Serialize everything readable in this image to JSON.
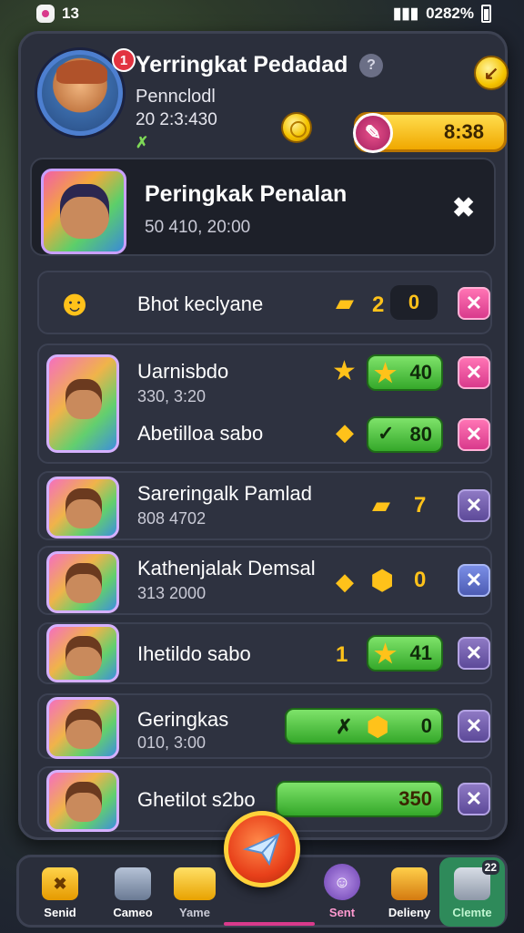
{
  "status_bar": {
    "left_text": "13",
    "right_text": "0282%"
  },
  "header": {
    "title": "Yerringkat Pedadad",
    "subtitle": "Pennclodl",
    "time": "20 2:3:430",
    "notification_count": "1",
    "help_label": "?",
    "pill_value": "8:38",
    "small_icon_text": "✗"
  },
  "featured": {
    "title": "Peringkak Penalan",
    "time": "50 410, 20:00",
    "close_label": "✖"
  },
  "rows": [
    {
      "name": "Bhot keclyane",
      "number": "2",
      "value": "0"
    },
    {
      "name": "Uarnisbdo",
      "sub": "330, 3:20",
      "value": "40"
    },
    {
      "name": "Abetilloa sabo",
      "value": "80"
    },
    {
      "name": "Sareringalk Pamlad",
      "sub": "808 4702",
      "value": "7"
    },
    {
      "name": "Kathenjalak Demsal",
      "sub": "313 2000",
      "value": "0"
    },
    {
      "name": "Ihetildo sabo",
      "number": "1",
      "value": "41"
    },
    {
      "name": "Geringkas",
      "sub": "010, 3:00",
      "value": "0"
    },
    {
      "name": "Ghetilot s2bo",
      "value": "350"
    }
  ],
  "bottom_nav": [
    {
      "label": "Senid",
      "icon": "shield-icon"
    },
    {
      "label": "Cameo",
      "icon": "gift-icon"
    },
    {
      "label": "Yame",
      "icon": "chest-icon"
    },
    {
      "label": "Sent",
      "icon": "chat-icon"
    },
    {
      "label": "Delieny",
      "icon": "box-icon"
    },
    {
      "label": "Clemte",
      "icon": "mail-icon",
      "badge": "22"
    }
  ],
  "colors": {
    "panel": "#2b2f3c",
    "gold": "#ffc21a",
    "green": "#4cc23a",
    "pink": "#d93a8c"
  }
}
